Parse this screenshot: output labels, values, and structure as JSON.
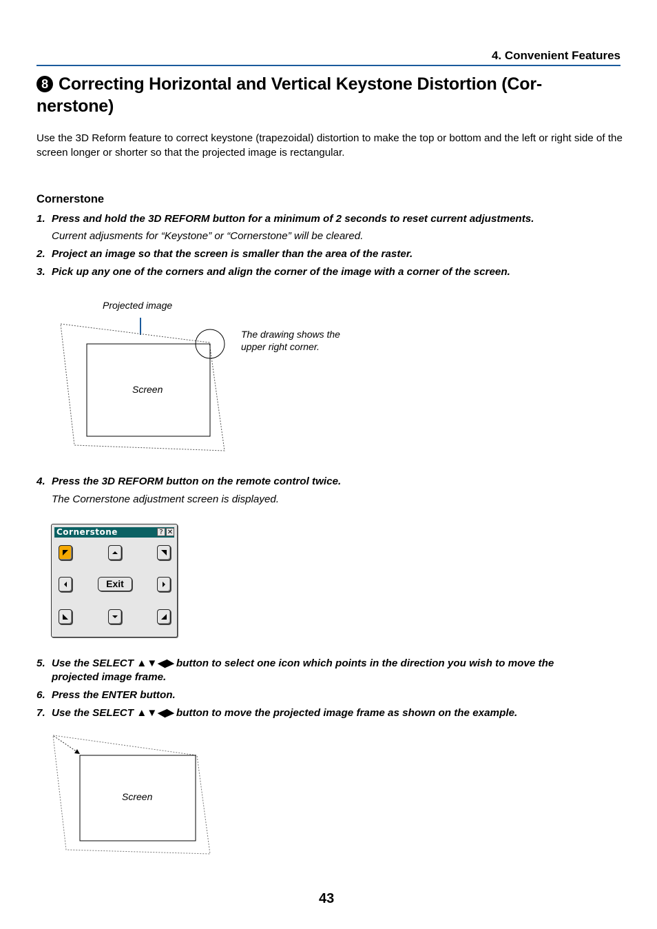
{
  "header": {
    "section": "4. Convenient Features"
  },
  "title": {
    "number_glyph": "8",
    "text": "Correcting Horizontal and Vertical Keystone Distortion (Cor-nerstone)",
    "line1": "Correcting Horizontal and Vertical Keystone Distortion (Cor-",
    "line2": "nerstone)"
  },
  "intro": "Use the 3D Reform feature to correct keystone (trapezoidal) distortion to make the top or bottom and the left or right side of the screen longer or shorter so that the projected image is rectangular.",
  "subheading": "Cornerstone",
  "steps": [
    {
      "n": "1.",
      "text": "Press and hold the 3D REFORM button for a minimum of 2 seconds to reset current adjustments.",
      "note": "Current adjusments for “Keystone” or “Cornerstone” will be cleared."
    },
    {
      "n": "2.",
      "text": "Project an image so that the screen is smaller than the area of the raster."
    },
    {
      "n": "3.",
      "text": "Pick up any one of the corners and align the corner of the image with a corner of the screen."
    },
    {
      "n": "4.",
      "text": "Press the 3D REFORM button on the remote control twice.",
      "note": "The Cornerstone adjustment screen is displayed."
    },
    {
      "n": "5.",
      "text": "Use the SELECT ▲▼◀▶ button to select one icon which points in the direction you wish to move the",
      "text2": "projected image frame."
    },
    {
      "n": "6.",
      "text": "Press the ENTER button."
    },
    {
      "n": "7.",
      "text": "Use the SELECT ▲▼◀▶ button to move the projected image frame as shown on the example."
    }
  ],
  "diagram1": {
    "projected_label": "Projected image",
    "screen_label": "Screen",
    "callout_line1": "The drawing shows the",
    "callout_line2": "upper right corner."
  },
  "osd": {
    "title": "Cornerstone",
    "help_glyph": "?",
    "close_glyph": "✕",
    "exit_label": "Exit",
    "selected_button": "upper-left",
    "accent_color": "#f5a800",
    "title_bar_color": "#0b6163"
  },
  "diagram2": {
    "screen_label": "Screen"
  },
  "page_number": "43"
}
